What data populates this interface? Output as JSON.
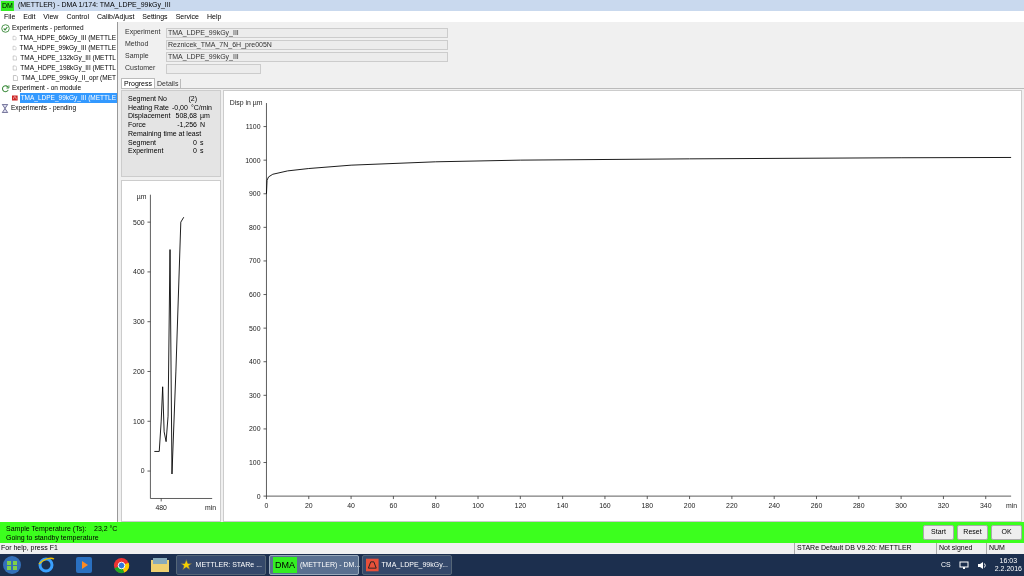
{
  "window": {
    "title": "(METTLER) - DMA 1/174: TMA_LDPE_99kGy_III",
    "icon_text": "DM"
  },
  "menu": [
    "File",
    "Edit",
    "View",
    "Control",
    "Calib/Adjust",
    "Settings",
    "Service",
    "Help"
  ],
  "tree": [
    {
      "label": "Experiments - performed",
      "kind": "performed",
      "children": [
        {
          "label": "TMA_HDPE_66kGy_III (METTLE",
          "selected": false
        },
        {
          "label": "TMA_HDPE_99kGy_III (METTLE",
          "selected": false
        },
        {
          "label": "TMA_HDPE_132kGy_III (METTL",
          "selected": false
        },
        {
          "label": "TMA_HDPE_198kGy_III (METTL",
          "selected": false
        },
        {
          "label": "TMA_LDPE_99kGy_II_opr (MET",
          "selected": false
        }
      ]
    },
    {
      "label": "Experiment - on module",
      "kind": "module",
      "children": [
        {
          "label": "TMA_LDPE_99kGy_III (METTLE",
          "selected": true
        }
      ]
    },
    {
      "label": "Experiments - pending",
      "kind": "pending"
    }
  ],
  "fields": [
    {
      "label": "Experiment",
      "value": "TMA_LDPE_99kGy_III"
    },
    {
      "label": "Method",
      "value": "Reznicek_TMA_7N_6H_pre005N"
    },
    {
      "label": "Sample",
      "value": "TMA_LDPE_99kGy_III"
    },
    {
      "label": "Customer"
    }
  ],
  "tabs": [
    {
      "label": "Progress",
      "selected": true
    },
    {
      "label": "Details",
      "selected": false
    }
  ],
  "info": [
    {
      "kind": "row",
      "label": "Segment No",
      "value": "(2)"
    },
    {
      "kind": "row",
      "label": "Heating Rate",
      "value": "-0,00",
      "unit": "°C/min"
    },
    {
      "kind": "row",
      "label": "Displacement",
      "value": "508,68",
      "unit": "µm"
    },
    {
      "kind": "row",
      "label": "Force",
      "value": "-1,256",
      "unit": "N"
    },
    {
      "kind": "heading",
      "label": "Remaining time at least"
    },
    {
      "kind": "row",
      "label": "Segment",
      "value": "0",
      "unit": "s"
    },
    {
      "kind": "row",
      "label": "Experiment",
      "value": "0",
      "unit": "s"
    }
  ],
  "small_chart": {
    "y_unit": "µm",
    "x_unit": "min",
    "x_label": "480",
    "y_labels": [
      "500",
      "400",
      "300",
      "200",
      "100",
      "0"
    ]
  },
  "main_chart": {
    "chart_data": {
      "type": "line",
      "ylabel": "Disp in µm",
      "xlabel": "min",
      "xlim": [
        0,
        352
      ],
      "ylim": [
        0,
        1170
      ],
      "xticks": [
        {
          "value": 0,
          "label": "0"
        },
        {
          "value": 20,
          "label": "20"
        },
        {
          "value": 40,
          "label": "40"
        },
        {
          "value": 60,
          "label": "60"
        },
        {
          "value": 80,
          "label": "80"
        },
        {
          "value": 100,
          "label": "100"
        },
        {
          "value": 120,
          "label": "120"
        },
        {
          "value": 140,
          "label": "140"
        },
        {
          "value": 160,
          "label": "160"
        },
        {
          "value": 180,
          "label": "180"
        },
        {
          "value": 200,
          "label": "200"
        },
        {
          "value": 220,
          "label": "220"
        },
        {
          "value": 240,
          "label": "240"
        },
        {
          "value": 260,
          "label": "260"
        },
        {
          "value": 280,
          "label": "280"
        },
        {
          "value": 300,
          "label": "300"
        },
        {
          "value": 320,
          "label": "320"
        },
        {
          "value": 340,
          "label": "340"
        }
      ],
      "yticks": [
        {
          "value": 0,
          "label": "0"
        },
        {
          "value": 100,
          "label": "100"
        },
        {
          "value": 200,
          "label": "200"
        },
        {
          "value": 300,
          "label": "300"
        },
        {
          "value": 400,
          "label": "400"
        },
        {
          "value": 500,
          "label": "500"
        },
        {
          "value": 600,
          "label": "600"
        },
        {
          "value": 700,
          "label": "700"
        },
        {
          "value": 800,
          "label": "800"
        },
        {
          "value": 900,
          "label": "900"
        },
        {
          "value": 1000,
          "label": "1000"
        },
        {
          "value": 1100,
          "label": "1100"
        }
      ],
      "x": [
        0,
        0.3,
        1,
        3,
        10,
        20,
        40,
        80,
        120,
        200,
        300,
        352
      ],
      "series": [
        {
          "color": "#000000",
          "values": [
            900,
            940,
            950,
            958,
            968,
            975,
            985,
            995,
            1000,
            1004,
            1007,
            1008
          ]
        }
      ]
    }
  },
  "status": {
    "label": "Sample Temperature (Ts):",
    "value": "23,2 °C",
    "message": "Going to standby temperature"
  },
  "buttons": [
    "Start",
    "Reset",
    "OK"
  ],
  "status_bar": {
    "help": "For help, press F1",
    "db": "STARe Default DB V9.20: METTLER",
    "signed": "Not signed",
    "num": "NUM"
  },
  "taskbar": {
    "apps": [
      {
        "kind": "star",
        "label": "METTLER: STARe ...",
        "active": false
      },
      {
        "kind": "dma",
        "icon_text": "DMA",
        "label": "(METTLER) - DM...",
        "active": true
      },
      {
        "kind": "red",
        "label": "TMA_LDPE_99kGy...",
        "active": false
      }
    ],
    "lang": "CS",
    "time": "16:03",
    "date": "2.2.2016"
  }
}
